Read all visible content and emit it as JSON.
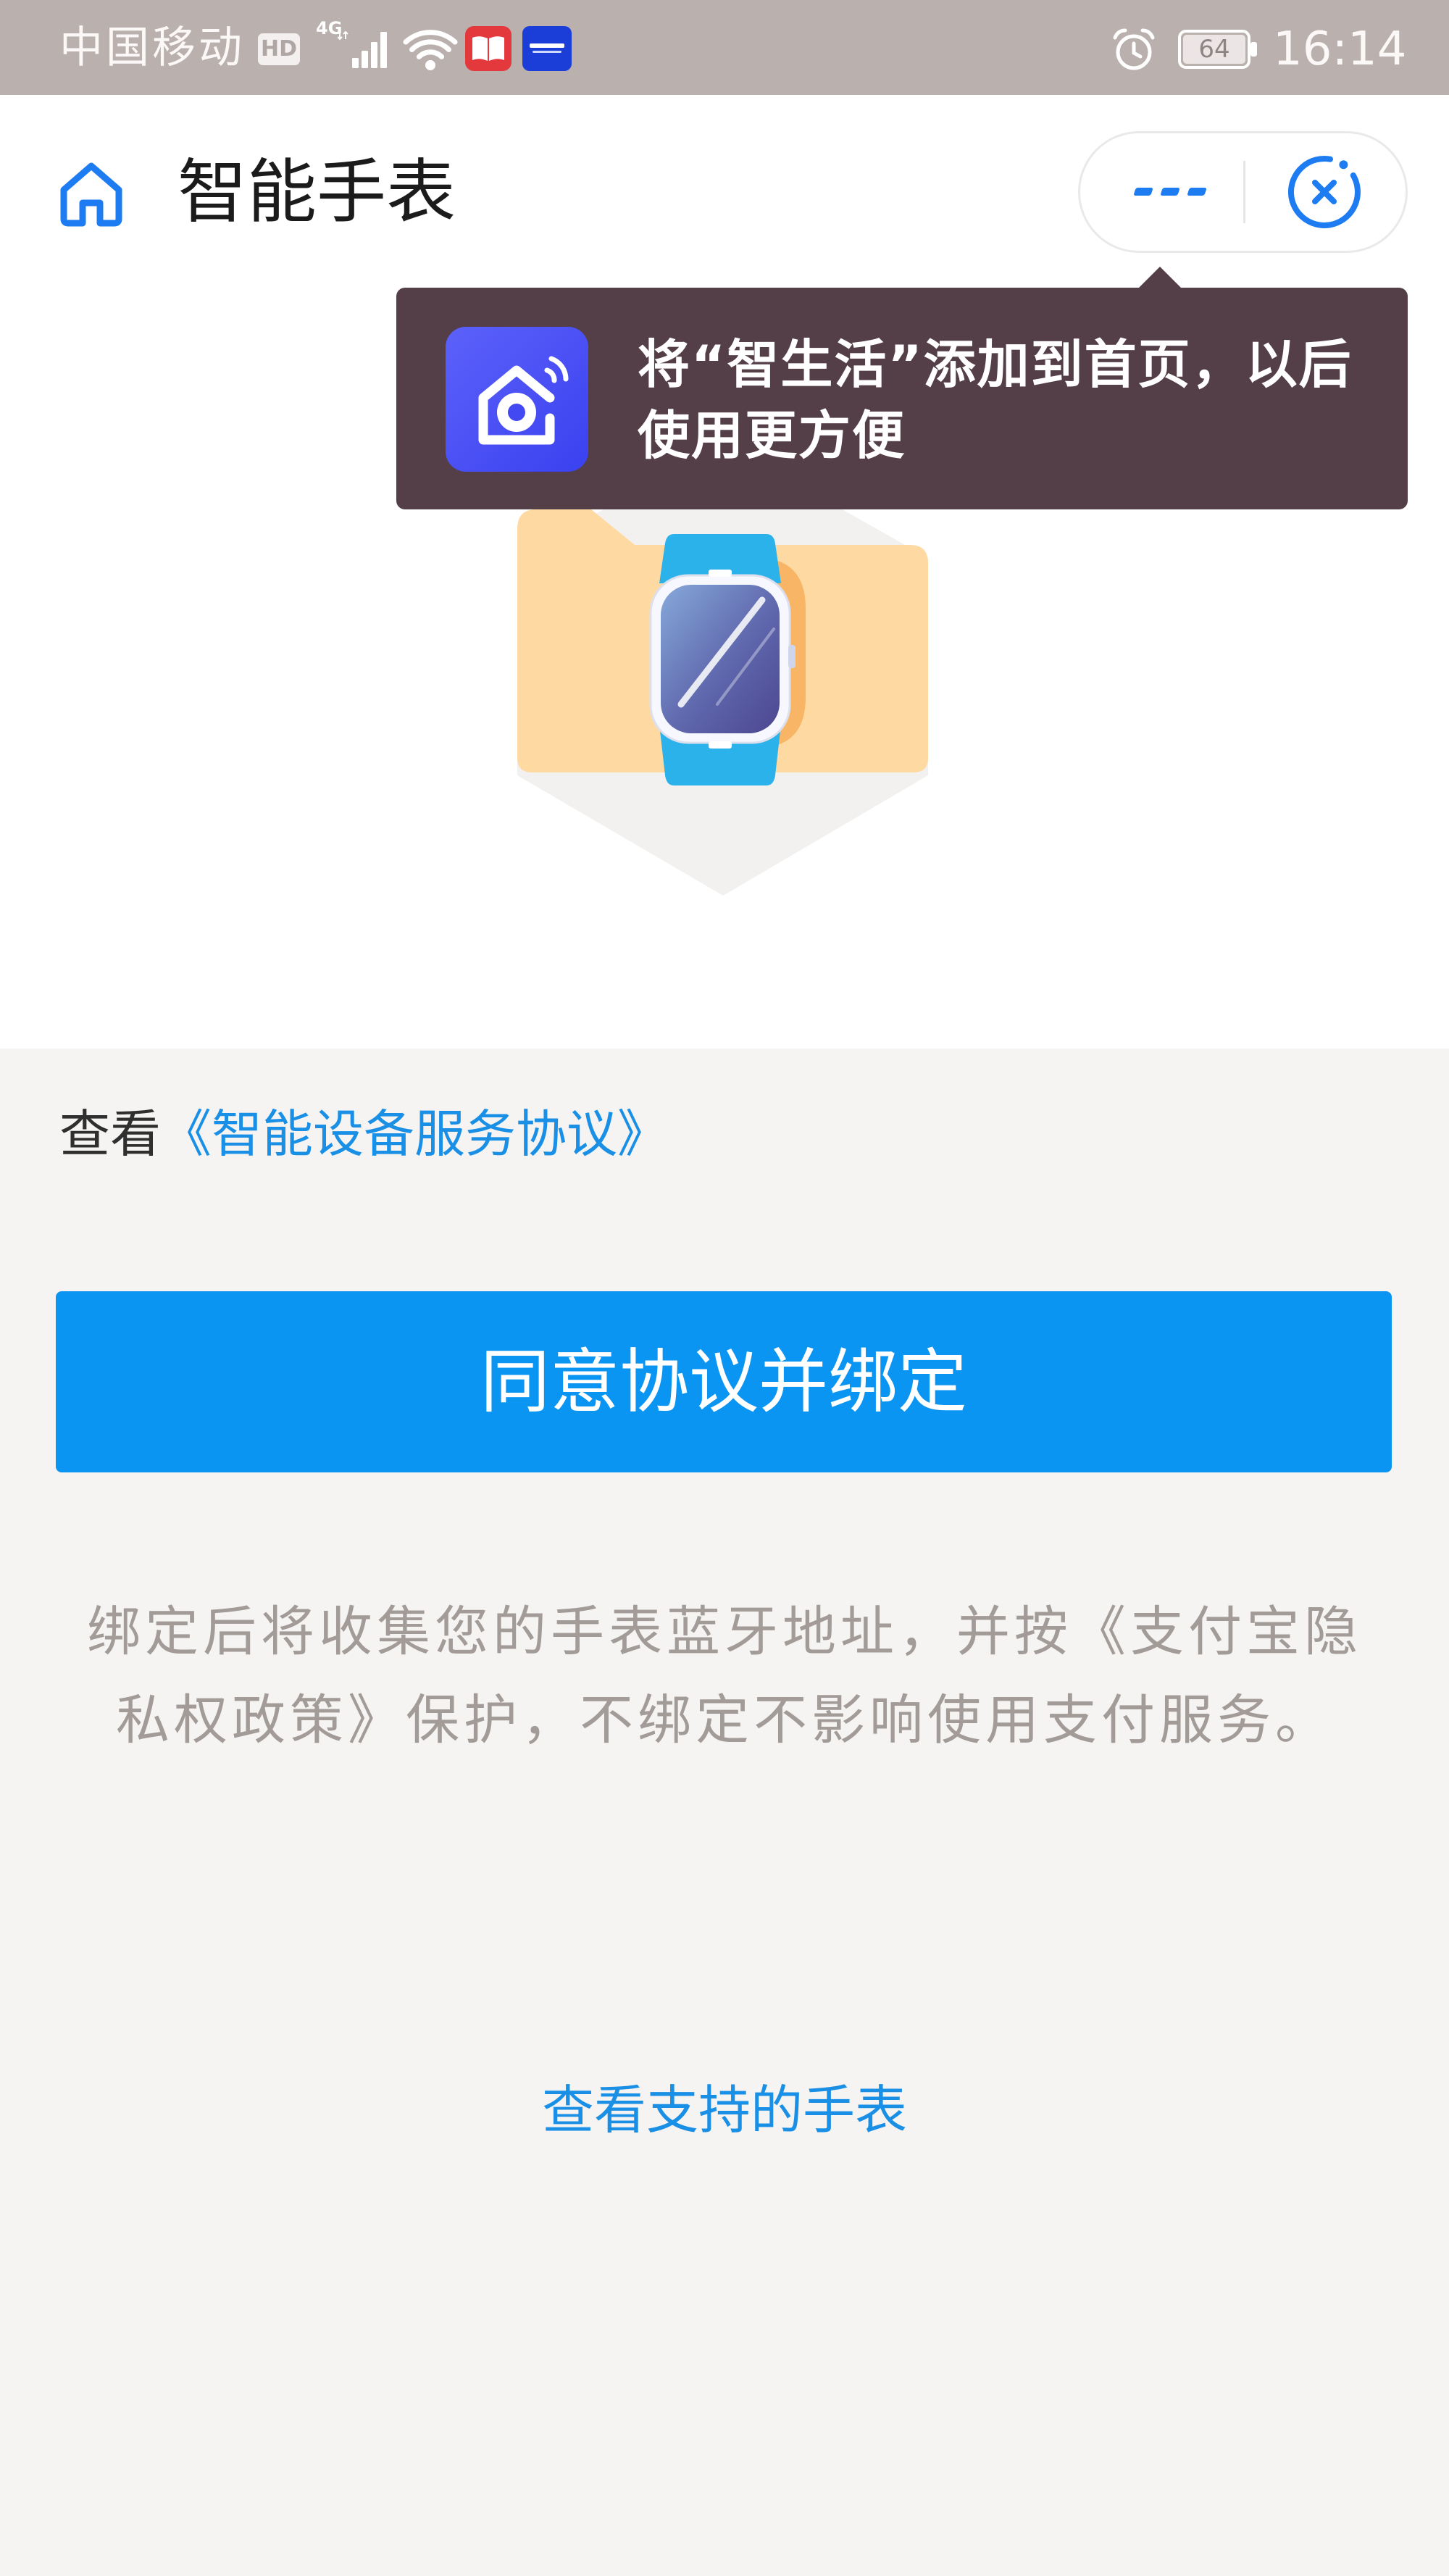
{
  "status_bar": {
    "carrier": "中国移动",
    "hd_badge": "HD",
    "network": "4G",
    "icons": [
      "signal-icon",
      "wifi-icon",
      "book-app-icon",
      "autohome-app-icon",
      "alarm-icon",
      "battery-icon"
    ],
    "battery_level": "64",
    "time": "16:14"
  },
  "header": {
    "home_icon": "home-icon",
    "title": "智能手表",
    "more_icon": "more-dots-icon",
    "close_icon": "close-circle-icon"
  },
  "tooltip": {
    "icon": "smart-home-app-icon",
    "lines": [
      "将“智生活”添加到首页，以后",
      "使用更方便"
    ]
  },
  "illustration": {
    "icon": "smartwatch-illustration"
  },
  "agreement": {
    "prefix": "查看",
    "link": "《智能设备服务协议》"
  },
  "bind_button": {
    "label": "同意协议并绑定"
  },
  "notice": {
    "lines": [
      "绑定后将收集您的手表蓝牙地址，并按《支付宝隐",
      "私权政策》保护，不绑定不影响使用支付服务。"
    ]
  },
  "support_link": {
    "label": "查看支持的手表"
  },
  "colors": {
    "status_bar_bg": "#bab1ae",
    "tooltip_bg": "#543f49",
    "primary_blue": "#0b95f3",
    "link_blue": "#1a8fe6",
    "icon_blue": "#1d7cf2",
    "page_bg": "#f5f4f3",
    "notice_text": "#a29b97"
  }
}
